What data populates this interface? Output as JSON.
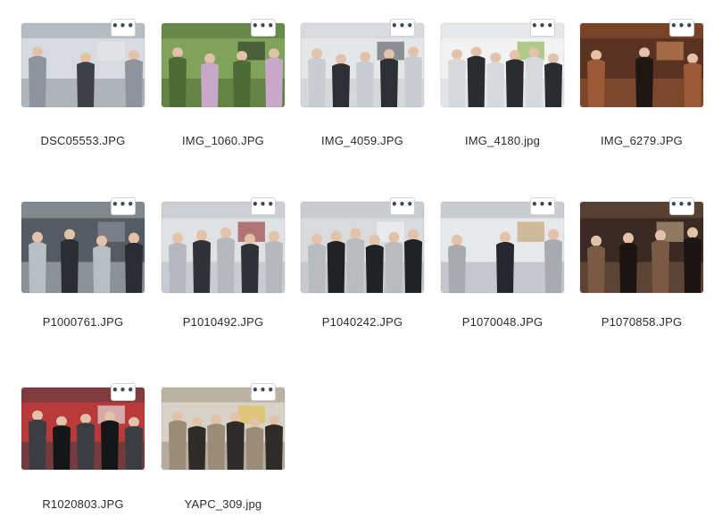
{
  "files": [
    {
      "name": "DSC05553.JPG",
      "palette": [
        "#d7dbe0",
        "#8e949b",
        "#3f4046",
        "#e6e6e6"
      ]
    },
    {
      "name": "IMG_1060.JPG",
      "palette": [
        "#7fa35a",
        "#4c6b35",
        "#c8a8c8",
        "#2f3a2a"
      ]
    },
    {
      "name": "IMG_4059.JPG",
      "palette": [
        "#e5e6e8",
        "#c9ccd0",
        "#2c2f33",
        "#5c6066"
      ]
    },
    {
      "name": "IMG_4180.jpg",
      "palette": [
        "#f2f2f2",
        "#d7d9dc",
        "#2a2c30",
        "#8ab34b"
      ]
    },
    {
      "name": "IMG_6279.JPG",
      "palette": [
        "#5a3222",
        "#9b5a35",
        "#1e1714",
        "#c98a56"
      ]
    },
    {
      "name": "P1000761.JPG",
      "palette": [
        "#545b63",
        "#b9bec3",
        "#2a2d31",
        "#8d9399"
      ]
    },
    {
      "name": "P1010492.JPG",
      "palette": [
        "#dfe1e4",
        "#b5b9be",
        "#2f3236",
        "#9a3b3b"
      ]
    },
    {
      "name": "P1040242.JPG",
      "palette": [
        "#d8dadc",
        "#b9bcbf",
        "#202225",
        "#f2f2f2"
      ]
    },
    {
      "name": "P1070048.JPG",
      "palette": [
        "#e7e8ea",
        "#a7abb0",
        "#24272b",
        "#c3a06f"
      ]
    },
    {
      "name": "P1070858.JPG",
      "palette": [
        "#3b2a23",
        "#7a5a45",
        "#1a1513",
        "#c0a383"
      ]
    },
    {
      "name": "R1020803.JPG",
      "palette": [
        "#b93a3a",
        "#3b3d42",
        "#151618",
        "#e7e7e7"
      ]
    },
    {
      "name": "YAPC_309.jpg",
      "palette": [
        "#d7d2c8",
        "#9b8c78",
        "#2e2b28",
        "#e0c04b"
      ]
    }
  ],
  "more_button_icon": "ellipsis-icon",
  "more_button_glyph": "•••"
}
